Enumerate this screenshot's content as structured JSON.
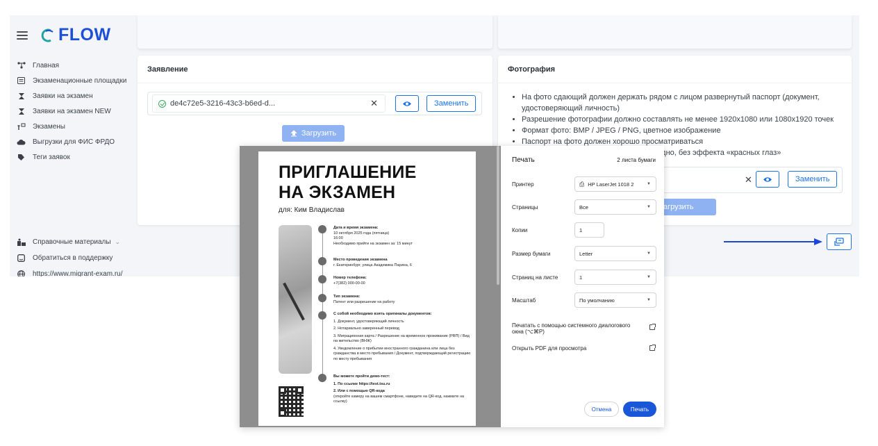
{
  "brand": {
    "name": "FLOW"
  },
  "sidebar": {
    "items": [
      {
        "label": "Главная",
        "icon": "home-network-icon"
      },
      {
        "label": "Экзаменационные площадки",
        "icon": "list-icon"
      },
      {
        "label": "Заявки на экзамен",
        "icon": "hourglass-icon"
      },
      {
        "label": "Заявки на экзамен NEW",
        "icon": "hourglass-icon"
      },
      {
        "label": "Экзамены",
        "icon": "exam-icon"
      },
      {
        "label": "Выгрузки для ФИС ФРДО",
        "icon": "cloud-upload-icon"
      },
      {
        "label": "Теги заявок",
        "icon": "tag-icon"
      }
    ],
    "bottom": [
      {
        "label": "Справочные материалы",
        "icon": "materials-icon"
      },
      {
        "label": "Обратиться в поддержку",
        "icon": "support-icon"
      },
      {
        "label": "https://www.migrant-exam.ru/",
        "icon": "globe-icon"
      }
    ]
  },
  "application_card": {
    "title": "Заявление",
    "file_name": "de4c72e5-3216-43c3-b6ed-d...",
    "replace_label": "Заменить",
    "upload_label": "Загрузить"
  },
  "photo_card": {
    "title": "Фотография",
    "requirements": [
      "На фото сдающий должен держать рядом с лицом развернутый паспорт (документ, удостоверяющий личность)",
      "Разрешение фотографии должно составлять не менее 1920x1080 или 1080x1920 точек",
      "Формат фото: BMP / JPEG / PNG, цветное изображение",
      "Паспорт на фото должен хорошо просматриваться",
      "идно, без эффекта «красных глаз»"
    ],
    "replace_label": "Заменить",
    "upload_label": "агрузить"
  },
  "print_dialog": {
    "title": "Печать",
    "pages_count": "2 листа бумаги",
    "printer_label": "Принтер",
    "printer_value": "HP LaserJet 1018 2",
    "pages_label": "Страницы",
    "pages_value": "Все",
    "copies_label": "Копии",
    "copies_value": "1",
    "paper_label": "Размер бумаги",
    "paper_value": "Letter",
    "per_sheet_label": "Страниц на листе",
    "per_sheet_value": "1",
    "scale_label": "Масштаб",
    "scale_value": "По умолчанию",
    "system_dialog": "Печатать с помощью системного диалогового окна (⌥⌘P)",
    "open_pdf": "Открыть PDF для просмотра",
    "cancel": "Отмена",
    "print": "Печать"
  },
  "invitation": {
    "title_line1": "ПРИГЛАШЕНИЕ",
    "title_line2": "НА ЭКЗАМЕН",
    "for_line": "для: Ким Владислав",
    "date_title": "Дата и время экзамена:",
    "date_value": "10 октября 2025 года (пятница)",
    "time_value": "16:00",
    "arrival_note": "Необходимо прийти на экзамен за: 15 минут",
    "place_title": "Место проведения экзамена",
    "place_value": "г. Екатеринбург, улица Академика Парина, 6",
    "phone_title": "Номер телефона:",
    "phone_value": "+7(382) 000-00-00",
    "type_title": "Тип экзамена:",
    "type_value": "Патент или разрешение на работу",
    "docs_title": "С собой необходимо взять оригиналы документов:",
    "docs": [
      "1. Документ, удостоверяющий личность",
      "2. Нотариально заверенный перевод",
      "3. Миграционная карта / Разрешение на временное проживание (РВП) / Вид на жительство (ВНЖ)",
      "4. Уведомление о прибытии иностранного гражданина или лица без гражданства в место пребывания / Документ, подтверждающий регистрацию по месту пребывания"
    ],
    "demo_title": "Вы можете пройти демо-тест:",
    "demo_link": "1. По ссылке  https://test.tsu.ru",
    "demo_qr": "2. Или с помощью QR-кода",
    "demo_qr_note": "(откройте камеру на вашем смартфоне, наведите на QR-код, нажмите на ссылку)"
  }
}
